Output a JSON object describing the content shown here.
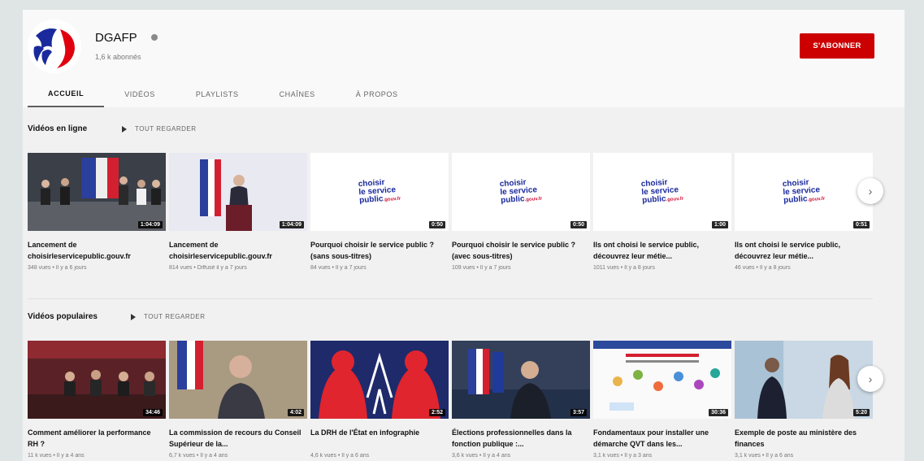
{
  "channel": {
    "name": "DGAFP",
    "subscribers": "1,6 k abonnés",
    "subscribe_label": "S'ABONNER",
    "colors": {
      "subscribe": "#cc0000",
      "logo_blue": "#1a2a9c",
      "logo_red": "#d3173d"
    }
  },
  "tabs": [
    {
      "label": "ACCUEIL",
      "active": true
    },
    {
      "label": "VIDÉOS"
    },
    {
      "label": "PLAYLISTS"
    },
    {
      "label": "CHAÎNES"
    },
    {
      "label": "À PROPOS"
    }
  ],
  "sections": [
    {
      "title": "Vidéos en ligne",
      "play_all": "TOUT REGARDER",
      "videos": [
        {
          "title": "Lancement de choisirleservicepublic.gouv.fr",
          "meta": "348 vues • Il y a 6 jours",
          "duration": "1:04:09"
        },
        {
          "title": "Lancement de choisirleservicepublic.gouv.fr",
          "meta": "814 vues • Diffusé il y a 7 jours",
          "duration": "1:04:09"
        },
        {
          "title": "Pourquoi choisir le service public ? (sans sous-titres)",
          "meta": "84 vues • Il y a 7 jours",
          "duration": "0:50",
          "logo": [
            "choisir",
            "le service",
            "public",
            ".gouv.fr"
          ]
        },
        {
          "title": "Pourquoi choisir le service public ? (avec sous-titres)",
          "meta": "109 vues • Il y a 7 jours",
          "duration": "0:50",
          "logo": [
            "choisir",
            "le service",
            "public",
            ".gouv.fr"
          ]
        },
        {
          "title": "Ils ont choisi le service public, découvrez leur métie...",
          "meta": "1011 vues • Il y a 8 jours",
          "duration": "1:00",
          "logo": [
            "choisir",
            "le service",
            "public",
            ".gouv.fr"
          ]
        },
        {
          "title": "Ils ont choisi le service public, découvrez leur métie...",
          "meta": "46 vues • Il y a 8 jours",
          "duration": "0:51",
          "logo": [
            "choisir",
            "le service",
            "public",
            ".gouv.fr"
          ]
        }
      ]
    },
    {
      "title": "Vidéos populaires",
      "play_all": "TOUT REGARDER",
      "videos": [
        {
          "title": "Comment améliorer la performance RH ?",
          "meta": "11 k vues • Il y a 4 ans",
          "duration": "34:46"
        },
        {
          "title": "La commission de recours du Conseil Supérieur de la...",
          "meta": "6,7 k vues • Il y a 4 ans",
          "duration": "4:02"
        },
        {
          "title": "La DRH de l'État en infographie",
          "meta": "4,6 k vues • Il y a 6 ans",
          "duration": "2:52"
        },
        {
          "title": "Élections professionnelles dans la fonction publique :...",
          "meta": "3,6 k vues • Il y a 4 ans",
          "duration": "3:57"
        },
        {
          "title": "Fondamentaux pour installer une démarche QVT dans les...",
          "meta": "3,1 k vues • Il y a 3 ans",
          "duration": "30:36"
        },
        {
          "title": "Exemple de poste au ministère des finances",
          "meta": "3,1 k vues • Il y a 6 ans",
          "duration": "5:20"
        }
      ]
    }
  ]
}
